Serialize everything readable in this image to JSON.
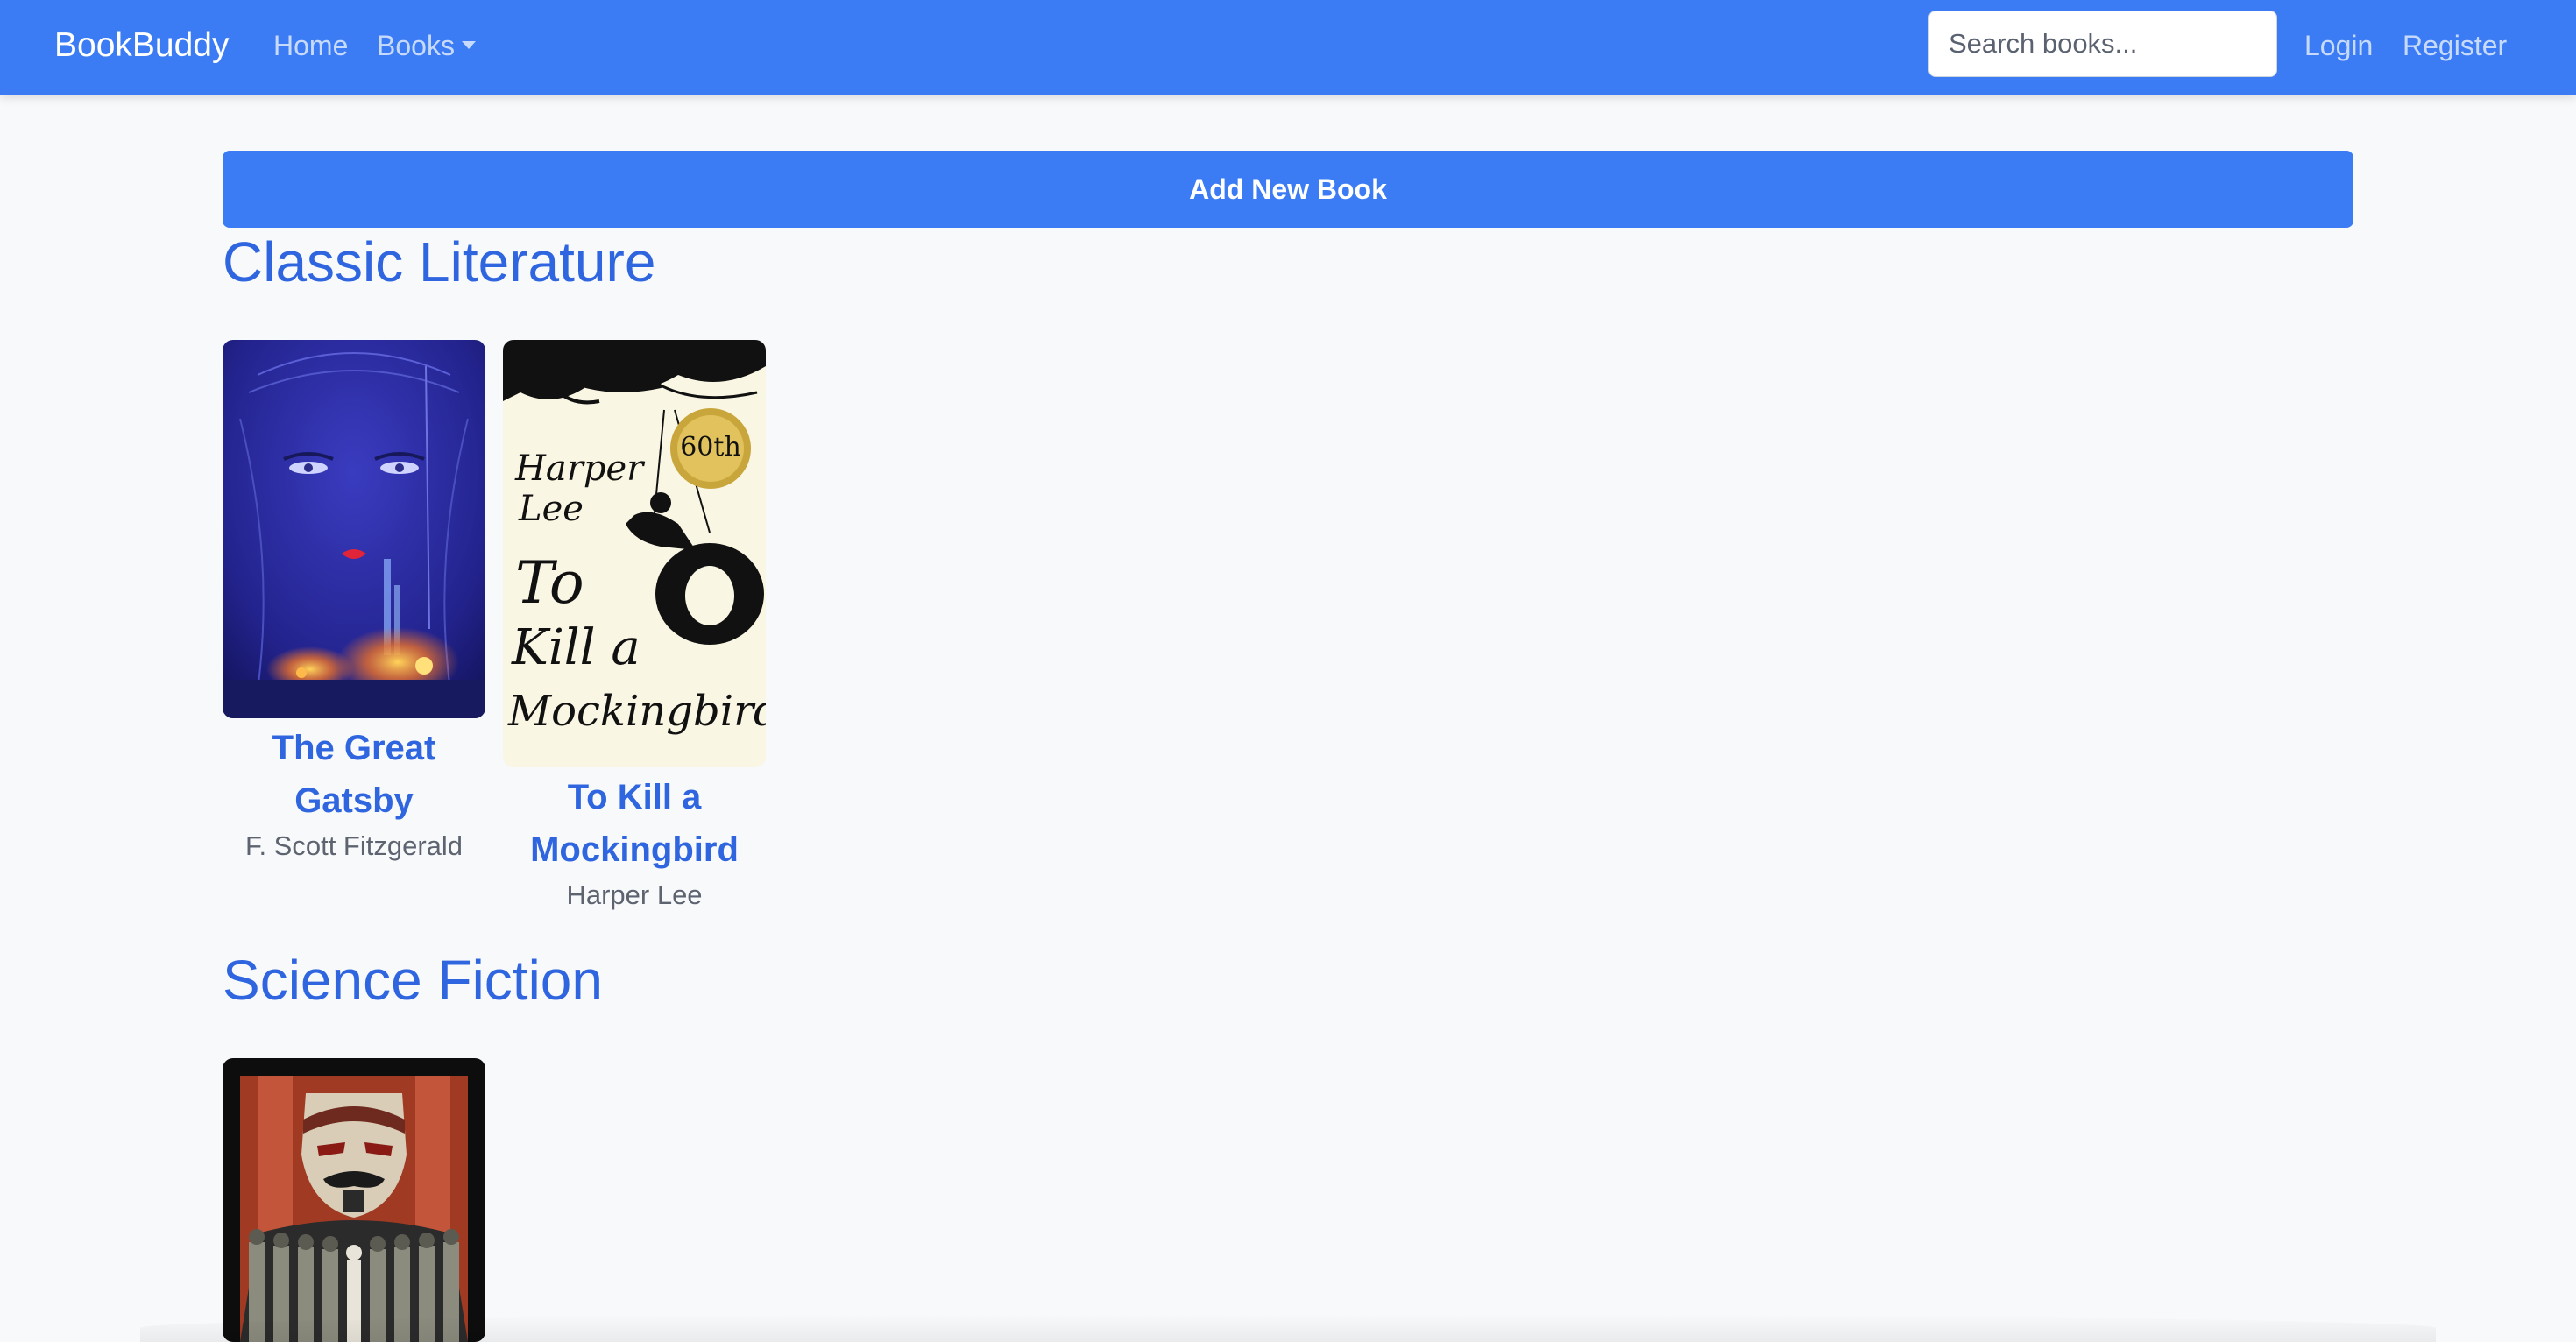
{
  "navbar": {
    "brand": "BookBuddy",
    "links": {
      "home": "Home",
      "books": "Books",
      "login": "Login",
      "register": "Register"
    },
    "search": {
      "placeholder": "Search books...",
      "value": ""
    }
  },
  "actions": {
    "add_book_label": "Add New Book"
  },
  "sections": [
    {
      "title": "Classic Literature",
      "books": [
        {
          "title": "The Great Gatsby",
          "author": "F. Scott Fitzgerald"
        },
        {
          "title": "To Kill a Mockingbird",
          "author": "Harper Lee"
        }
      ]
    },
    {
      "title": "Science Fiction",
      "books": [
        {
          "title": "",
          "author": ""
        }
      ]
    }
  ],
  "covers": {
    "mockingbird_text": {
      "author_first": "Harper",
      "author_last": "Lee",
      "line1": "To",
      "line2": "Kill a",
      "line3": "Mockingbird",
      "badge": "60th"
    }
  },
  "colors": {
    "primary": "#3b7cf4",
    "heading": "#2f66df",
    "background": "#f8f9fb"
  }
}
